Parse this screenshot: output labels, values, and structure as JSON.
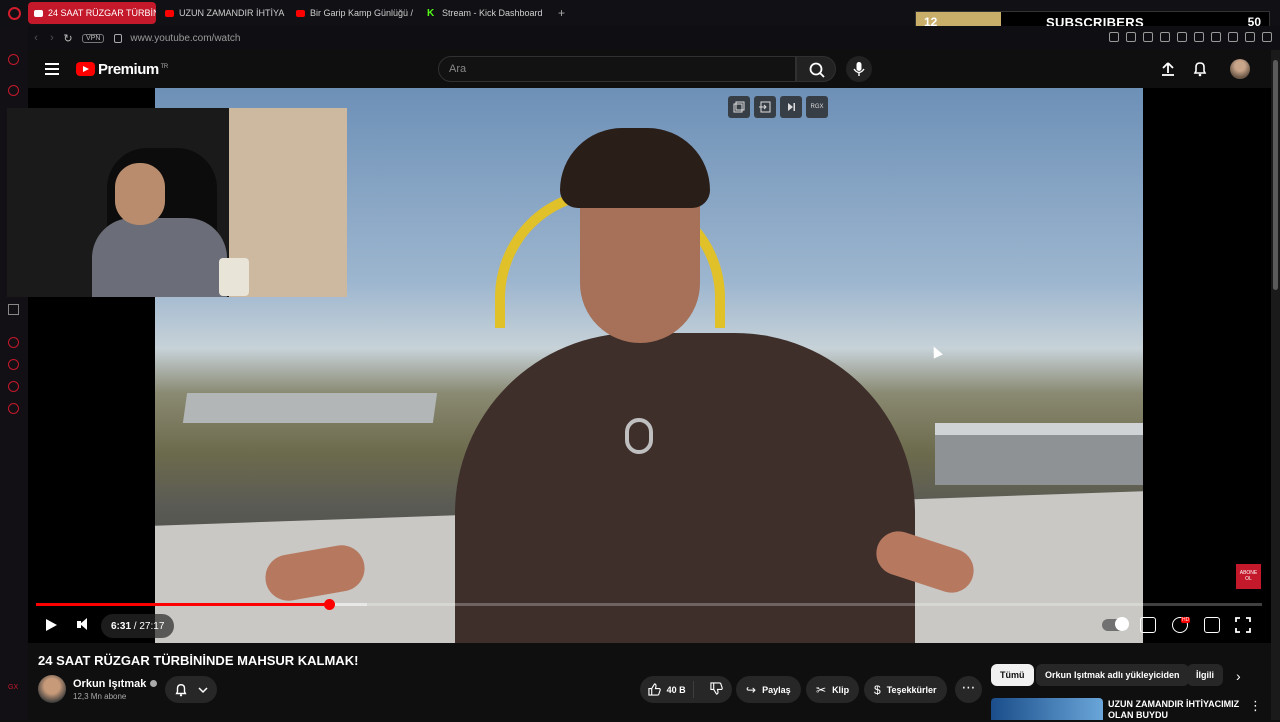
{
  "browser": {
    "tabs": [
      {
        "label": "24 SAAT RÜZGAR TÜRBİNİ",
        "active": true,
        "icon": "youtube-icon"
      },
      {
        "label": "UZUN ZAMANDIR İHTİYA",
        "active": false,
        "icon": "youtube-icon"
      },
      {
        "label": "Bir Garip Kamp Günlüğü /",
        "active": false,
        "icon": "youtube-icon"
      },
      {
        "label": "Stream - Kick Dashboard",
        "active": false,
        "icon": "kick-icon"
      }
    ],
    "new_tab": "+",
    "vpn_label": "VPN",
    "url": "www.youtube.com/watch",
    "accent": "#c4192b"
  },
  "stream_overlay": {
    "current": "12",
    "label": "SUBSCRIBERS",
    "goal": "50",
    "progress_fraction": 0.24
  },
  "sidebar": {
    "bottom_text": "GX"
  },
  "masthead": {
    "brand": "Premium",
    "brand_sup": "TR",
    "search_placeholder": "Ara",
    "icons": [
      "menu-icon",
      "search-icon",
      "mic-icon",
      "upload-icon",
      "bell-icon"
    ]
  },
  "player": {
    "top_buttons": [
      "",
      "",
      "",
      "RGX"
    ],
    "abone_text": "ABONE OL",
    "current_time": "6:31",
    "separator": " / ",
    "duration": "27:17",
    "played_fraction": 0.239,
    "buffered_fraction": 0.27,
    "quality_badge": "HD",
    "controls": [
      "play-icon",
      "volume-icon",
      "autoplay-toggle",
      "subtitles-icon",
      "settings-icon",
      "miniplayer-icon",
      "fullscreen-icon"
    ]
  },
  "video_info": {
    "title": "24 SAAT RÜZGAR TÜRBİNİNDE MAHSUR KALMAK!",
    "channel": "Orkun Işıtmak",
    "subscribers": "12,3 Mn abone",
    "likes": "40 B",
    "share_label": "Paylaş",
    "clip_label": "Klip",
    "thanks_label": "Teşekkürler",
    "more": "⋯"
  },
  "recommendations": {
    "chips": [
      {
        "label": "Tümü",
        "selected": true
      },
      {
        "label": "Orkun Işıtmak adlı yükleyiciden",
        "selected": false
      },
      {
        "label": "İlgili",
        "selected": false
      }
    ],
    "first_title": "UZUN ZAMANDIR İHTİYACIMIZ OLAN BUYDU"
  }
}
